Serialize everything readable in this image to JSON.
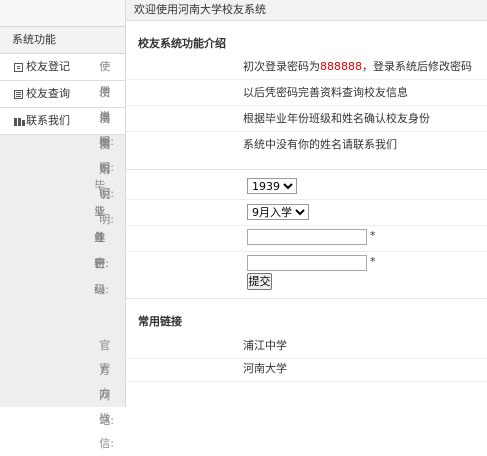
{
  "header": {
    "welcome": "欢迎使用河南大学校友系统"
  },
  "sidebar": {
    "section_title": "系统功能",
    "items": [
      {
        "label": "校友登记",
        "icon": "register-icon"
      },
      {
        "label": "校友查询",
        "icon": "document-icon"
      },
      {
        "label": "联系我们",
        "icon": "contact-icon"
      }
    ]
  },
  "intro": {
    "title": "校友系统功能介绍",
    "rows": [
      {
        "label": "使用说明:",
        "text_before": "初次登录密码为",
        "highlight": "888888",
        "text_after": "，登录系统后修改密码"
      },
      {
        "label": "使用说明:",
        "text": "以后凭密码完善资料查询校友信息"
      },
      {
        "label": "使用说明:",
        "text": "根据毕业年份班级和姓名确认校友身份"
      },
      {
        "label": "使用说明:",
        "text": "系统中没有你的姓名请联系我们"
      }
    ]
  },
  "form": {
    "year_label": "毕业年份:",
    "year_value": "1939",
    "class_label": "毕业班级:",
    "class_value": "9月入学",
    "name_label": "姓名:",
    "name_value": "",
    "password_label": "密码:",
    "password_value": "",
    "required_mark": "*",
    "submit_label": "提交"
  },
  "links": {
    "title": "常用链接",
    "rows": [
      {
        "label": "官方网站:",
        "value": "浦江中学"
      },
      {
        "label": "官方微信:",
        "value": "河南大学"
      }
    ]
  },
  "colors": {
    "highlight": "#e00000",
    "link": "#2a74c4"
  }
}
